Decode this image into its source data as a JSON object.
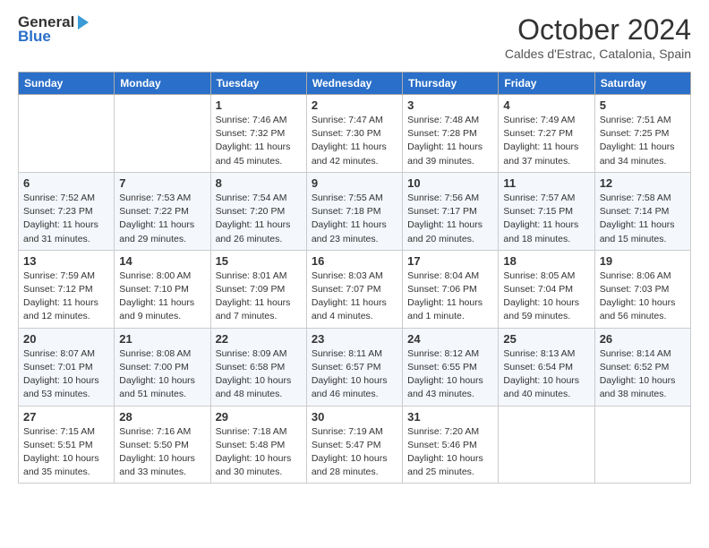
{
  "logo": {
    "line1": "General",
    "line2": "Blue"
  },
  "title": "October 2024",
  "location": "Caldes d'Estrac, Catalonia, Spain",
  "headers": [
    "Sunday",
    "Monday",
    "Tuesday",
    "Wednesday",
    "Thursday",
    "Friday",
    "Saturday"
  ],
  "weeks": [
    [
      {
        "day": "",
        "info": ""
      },
      {
        "day": "",
        "info": ""
      },
      {
        "day": "1",
        "info": "Sunrise: 7:46 AM\nSunset: 7:32 PM\nDaylight: 11 hours and 45 minutes."
      },
      {
        "day": "2",
        "info": "Sunrise: 7:47 AM\nSunset: 7:30 PM\nDaylight: 11 hours and 42 minutes."
      },
      {
        "day": "3",
        "info": "Sunrise: 7:48 AM\nSunset: 7:28 PM\nDaylight: 11 hours and 39 minutes."
      },
      {
        "day": "4",
        "info": "Sunrise: 7:49 AM\nSunset: 7:27 PM\nDaylight: 11 hours and 37 minutes."
      },
      {
        "day": "5",
        "info": "Sunrise: 7:51 AM\nSunset: 7:25 PM\nDaylight: 11 hours and 34 minutes."
      }
    ],
    [
      {
        "day": "6",
        "info": "Sunrise: 7:52 AM\nSunset: 7:23 PM\nDaylight: 11 hours and 31 minutes."
      },
      {
        "day": "7",
        "info": "Sunrise: 7:53 AM\nSunset: 7:22 PM\nDaylight: 11 hours and 29 minutes."
      },
      {
        "day": "8",
        "info": "Sunrise: 7:54 AM\nSunset: 7:20 PM\nDaylight: 11 hours and 26 minutes."
      },
      {
        "day": "9",
        "info": "Sunrise: 7:55 AM\nSunset: 7:18 PM\nDaylight: 11 hours and 23 minutes."
      },
      {
        "day": "10",
        "info": "Sunrise: 7:56 AM\nSunset: 7:17 PM\nDaylight: 11 hours and 20 minutes."
      },
      {
        "day": "11",
        "info": "Sunrise: 7:57 AM\nSunset: 7:15 PM\nDaylight: 11 hours and 18 minutes."
      },
      {
        "day": "12",
        "info": "Sunrise: 7:58 AM\nSunset: 7:14 PM\nDaylight: 11 hours and 15 minutes."
      }
    ],
    [
      {
        "day": "13",
        "info": "Sunrise: 7:59 AM\nSunset: 7:12 PM\nDaylight: 11 hours and 12 minutes."
      },
      {
        "day": "14",
        "info": "Sunrise: 8:00 AM\nSunset: 7:10 PM\nDaylight: 11 hours and 9 minutes."
      },
      {
        "day": "15",
        "info": "Sunrise: 8:01 AM\nSunset: 7:09 PM\nDaylight: 11 hours and 7 minutes."
      },
      {
        "day": "16",
        "info": "Sunrise: 8:03 AM\nSunset: 7:07 PM\nDaylight: 11 hours and 4 minutes."
      },
      {
        "day": "17",
        "info": "Sunrise: 8:04 AM\nSunset: 7:06 PM\nDaylight: 11 hours and 1 minute."
      },
      {
        "day": "18",
        "info": "Sunrise: 8:05 AM\nSunset: 7:04 PM\nDaylight: 10 hours and 59 minutes."
      },
      {
        "day": "19",
        "info": "Sunrise: 8:06 AM\nSunset: 7:03 PM\nDaylight: 10 hours and 56 minutes."
      }
    ],
    [
      {
        "day": "20",
        "info": "Sunrise: 8:07 AM\nSunset: 7:01 PM\nDaylight: 10 hours and 53 minutes."
      },
      {
        "day": "21",
        "info": "Sunrise: 8:08 AM\nSunset: 7:00 PM\nDaylight: 10 hours and 51 minutes."
      },
      {
        "day": "22",
        "info": "Sunrise: 8:09 AM\nSunset: 6:58 PM\nDaylight: 10 hours and 48 minutes."
      },
      {
        "day": "23",
        "info": "Sunrise: 8:11 AM\nSunset: 6:57 PM\nDaylight: 10 hours and 46 minutes."
      },
      {
        "day": "24",
        "info": "Sunrise: 8:12 AM\nSunset: 6:55 PM\nDaylight: 10 hours and 43 minutes."
      },
      {
        "day": "25",
        "info": "Sunrise: 8:13 AM\nSunset: 6:54 PM\nDaylight: 10 hours and 40 minutes."
      },
      {
        "day": "26",
        "info": "Sunrise: 8:14 AM\nSunset: 6:52 PM\nDaylight: 10 hours and 38 minutes."
      }
    ],
    [
      {
        "day": "27",
        "info": "Sunrise: 7:15 AM\nSunset: 5:51 PM\nDaylight: 10 hours and 35 minutes."
      },
      {
        "day": "28",
        "info": "Sunrise: 7:16 AM\nSunset: 5:50 PM\nDaylight: 10 hours and 33 minutes."
      },
      {
        "day": "29",
        "info": "Sunrise: 7:18 AM\nSunset: 5:48 PM\nDaylight: 10 hours and 30 minutes."
      },
      {
        "day": "30",
        "info": "Sunrise: 7:19 AM\nSunset: 5:47 PM\nDaylight: 10 hours and 28 minutes."
      },
      {
        "day": "31",
        "info": "Sunrise: 7:20 AM\nSunset: 5:46 PM\nDaylight: 10 hours and 25 minutes."
      },
      {
        "day": "",
        "info": ""
      },
      {
        "day": "",
        "info": ""
      }
    ]
  ]
}
